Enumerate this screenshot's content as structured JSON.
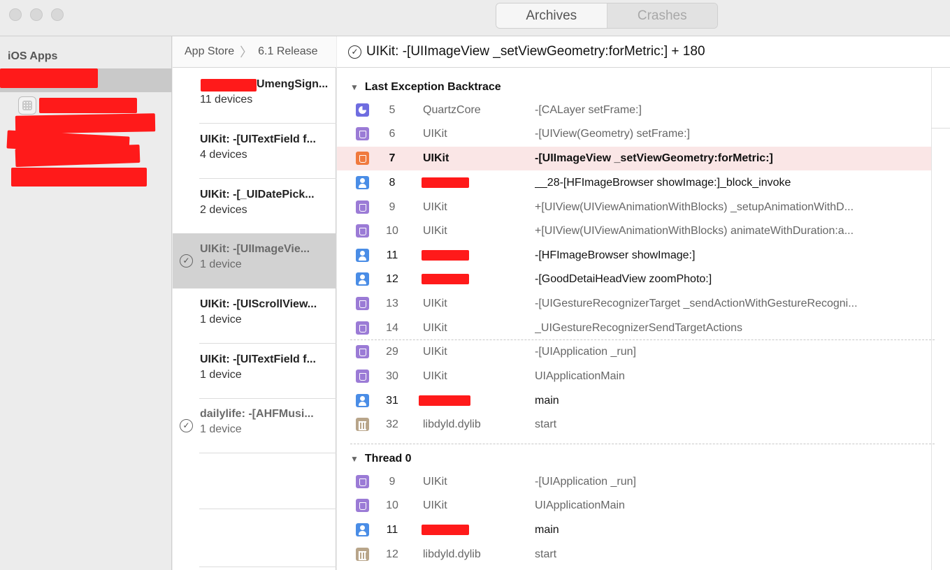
{
  "toolbar": {
    "segments": [
      "Archives",
      "Crashes"
    ]
  },
  "sidebar": {
    "header": "iOS Apps"
  },
  "breadcrumb": {
    "source": "App Store",
    "version": "6.1 Release"
  },
  "crash_list": [
    {
      "title": "UmengSign...",
      "devices": "11 devices"
    },
    {
      "title": "UIKit: -[UITextField f...",
      "devices": "4 devices"
    },
    {
      "title": "UIKit: -[_UIDatePick...",
      "devices": "2 devices"
    },
    {
      "title": "UIKit: -[UIImageVie...",
      "devices": "1 device"
    },
    {
      "title": "UIKit: -[UIScrollView...",
      "devices": "1 device"
    },
    {
      "title": "UIKit: -[UITextField f...",
      "devices": "1 device"
    },
    {
      "title": "dailylife: -[AHFMusi...",
      "devices": "1 device"
    }
  ],
  "detail": {
    "title": "UIKit: -[UIImageView _setViewGeometry:forMetric:] + 180",
    "sections": [
      "Last Exception Backtrace",
      "Thread 0"
    ],
    "backtrace": [
      {
        "num": "5",
        "lib": "QuartzCore",
        "symbol": "-[CALayer setFrame:]",
        "icon": "quartzcore-icon"
      },
      {
        "num": "6",
        "lib": "UIKit",
        "symbol": "-[UIView(Geometry) setFrame:]",
        "icon": "system-library-icon"
      },
      {
        "num": "7",
        "lib": "UIKit",
        "symbol": "-[UIImageView _setViewGeometry:forMetric:]",
        "icon": "system-library-icon"
      },
      {
        "num": "8",
        "lib": "",
        "symbol": "__28-[HFImageBrowser showImage:]_block_invoke",
        "icon": "user-code-icon"
      },
      {
        "num": "9",
        "lib": "UIKit",
        "symbol": "+[UIView(UIViewAnimationWithBlocks) _setupAnimationWithD...",
        "icon": "system-library-icon"
      },
      {
        "num": "10",
        "lib": "UIKit",
        "symbol": "+[UIView(UIViewAnimationWithBlocks) animateWithDuration:a...",
        "icon": "system-library-icon"
      },
      {
        "num": "11",
        "lib": "",
        "symbol": "-[HFImageBrowser showImage:]",
        "icon": "user-code-icon"
      },
      {
        "num": "12",
        "lib": "",
        "symbol": "-[GoodDetaiHeadView zoomPhoto:]",
        "icon": "user-code-icon"
      },
      {
        "num": "13",
        "lib": "UIKit",
        "symbol": "-[UIGestureRecognizerTarget _sendActionWithGestureRecogni...",
        "icon": "system-library-icon"
      },
      {
        "num": "14",
        "lib": "UIKit",
        "symbol": "_UIGestureRecognizerSendTargetActions",
        "icon": "system-library-icon"
      },
      {
        "num": "29",
        "lib": "UIKit",
        "symbol": "-[UIApplication _run]",
        "icon": "system-library-icon"
      },
      {
        "num": "30",
        "lib": "UIKit",
        "symbol": "UIApplicationMain",
        "icon": "system-library-icon"
      },
      {
        "num": "31",
        "lib": "",
        "symbol": "main",
        "icon": "user-code-icon"
      },
      {
        "num": "32",
        "lib": "libdyld.dylib",
        "symbol": "start",
        "icon": "dylib-icon"
      }
    ],
    "thread0": [
      {
        "num": "9",
        "lib": "UIKit",
        "symbol": "-[UIApplication _run]",
        "icon": "system-library-icon"
      },
      {
        "num": "10",
        "lib": "UIKit",
        "symbol": "UIApplicationMain",
        "icon": "system-library-icon"
      },
      {
        "num": "11",
        "lib": "",
        "symbol": "main",
        "icon": "user-code-icon"
      },
      {
        "num": "12",
        "lib": "libdyld.dylib",
        "symbol": "start",
        "icon": "dylib-icon"
      }
    ]
  },
  "colors": {
    "highlight_row": "#fae6e6",
    "redaction": "#ff1a1a",
    "system_library_icon": "#9b7bd6",
    "user_code_icon": "#4a8de6",
    "selected_frame_icon": "#f07a3e"
  }
}
